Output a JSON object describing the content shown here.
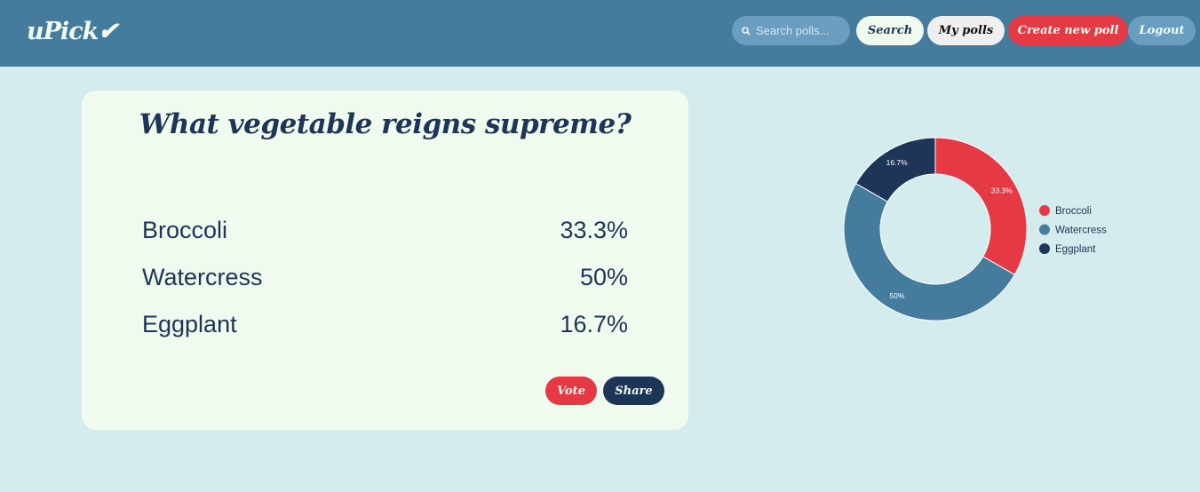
{
  "header": {
    "logo": "uPick✔",
    "search_placeholder": "Search polls...",
    "search_label": "Search",
    "my_polls_label": "My polls",
    "create_label": "Create new poll",
    "logout_label": "Logout"
  },
  "poll": {
    "question": "What vegetable reigns supreme?",
    "options": [
      {
        "label": "Broccoli",
        "percent": "33.3%"
      },
      {
        "label": "Watercress",
        "percent": "50%"
      },
      {
        "label": "Eggplant",
        "percent": "16.7%"
      }
    ],
    "vote_label": "Vote",
    "share_label": "Share"
  },
  "colors": {
    "navbar": "#457b9d",
    "background": "#d4ecee",
    "card": "#f1faee",
    "accent_red": "#e63946",
    "navy": "#1d3557"
  },
  "chart_data": {
    "type": "pie",
    "categories": [
      "Broccoli",
      "Watercress",
      "Eggplant"
    ],
    "values": [
      33.3,
      50,
      16.7
    ],
    "labels": [
      "33.3%",
      "50%",
      "16.7%"
    ],
    "colors": [
      "#e63946",
      "#457b9d",
      "#1d3557"
    ],
    "legend": "right"
  }
}
